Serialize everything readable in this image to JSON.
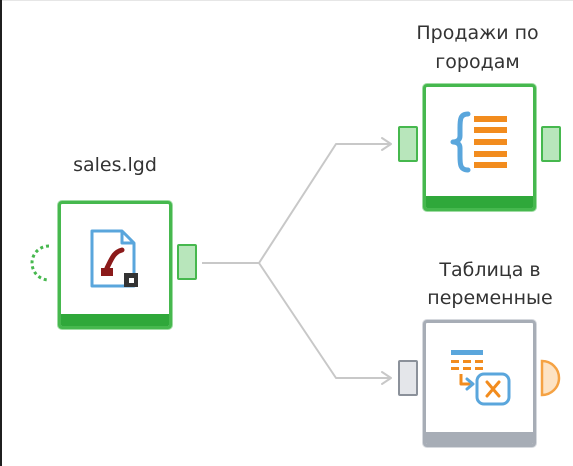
{
  "canvas": {
    "nodes": [
      {
        "id": "sales-file",
        "label": "sales.lgd",
        "icon": "data-file-icon",
        "status": "completed",
        "status_color": "#2fa83a"
      },
      {
        "id": "sales-by-city",
        "label_line1": "Продажи по",
        "label_line2": "городам",
        "icon": "grouped-list-icon",
        "status": "completed",
        "status_color": "#2fa83a"
      },
      {
        "id": "table-to-variables",
        "label_line1": "Таблица в",
        "label_line2": "переменные",
        "icon": "table-to-variable-icon",
        "status": "not-executed",
        "status_color": "#a7adb6"
      }
    ],
    "connections": [
      {
        "from": "sales-file",
        "to": "sales-by-city"
      },
      {
        "from": "sales-file",
        "to": "table-to-variables"
      }
    ],
    "colors": {
      "success": "#46b84e",
      "inactive": "#a7adb6",
      "link": "#c8c8c8",
      "variable_port": "#f5a243",
      "accent_orange": "#f28c1e",
      "accent_blue": "#5aa6dc"
    }
  }
}
